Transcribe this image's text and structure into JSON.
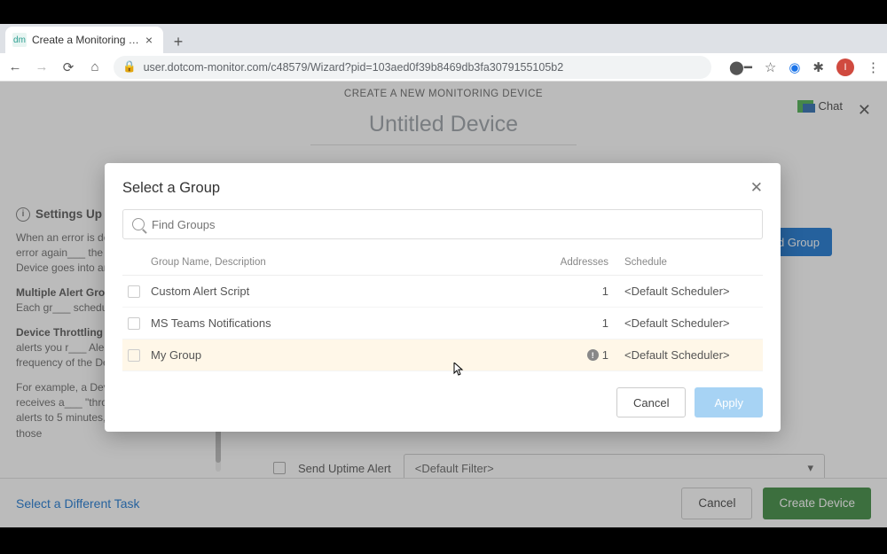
{
  "window": {
    "minimize": "—",
    "maximize": "□",
    "close": "×"
  },
  "tab": {
    "favicon_text": "dm",
    "title": "Create a Monitoring Device",
    "close": "×",
    "new_tab": "+"
  },
  "nav": {
    "back": "←",
    "forward": "→",
    "reload": "⟳",
    "home": "⌂",
    "lock": "🔒",
    "url": "user.dotcom-monitor.com/c48579/Wizard?pid=103aed0f39b8469db3fa3079155105b2",
    "key": "⬤━",
    "star": "☆",
    "ext1": "◉",
    "ext2": "✱",
    "avatar": "I",
    "menu": "⋮"
  },
  "page": {
    "header": "CREATE A NEW MONITORING DEVICE",
    "chat": "Chat",
    "close": "✕",
    "device_title": "Untitled Device",
    "add_group": "d Group",
    "info": {
      "title": "Settings Up A",
      "p1": "When an error is detec___ checks the error again___ the Device does not fil___ Device goes into an Al___",
      "p2b": "Multiple Alert Groups",
      "p2": " receive alerts. Each gr___ schedule and escalati___",
      "p3b": "Device Throttling",
      "p3": " allo___ number of alerts you r___ Alert frequency match___ frequency of the Devic___",
      "p4": "For example, a Device___ monitoring receives a___ \"throttling\" Email and SMS alerts to 5 minutes, Alerts would be sent to those"
    },
    "send_uptime": "Send Uptime Alert",
    "default_filter": "<Default Filter>",
    "dropdown_caret": "▾"
  },
  "modal": {
    "title": "Select a Group",
    "close": "✕",
    "search_placeholder": "Find Groups",
    "cols": {
      "name": "Group Name, Description",
      "addresses": "Addresses",
      "schedule": "Schedule"
    },
    "rows": [
      {
        "name": "Custom Alert Script",
        "addresses": "1",
        "schedule": "<Default Scheduler>",
        "warn": false
      },
      {
        "name": "MS Teams Notifications",
        "addresses": "1",
        "schedule": "<Default Scheduler>",
        "warn": false
      },
      {
        "name": "My Group",
        "addresses": "1",
        "schedule": "<Default Scheduler>",
        "warn": true
      }
    ],
    "cancel": "Cancel",
    "apply": "Apply"
  },
  "bottom": {
    "select_task": "Select a Different Task",
    "cancel": "Cancel",
    "create": "Create Device"
  }
}
